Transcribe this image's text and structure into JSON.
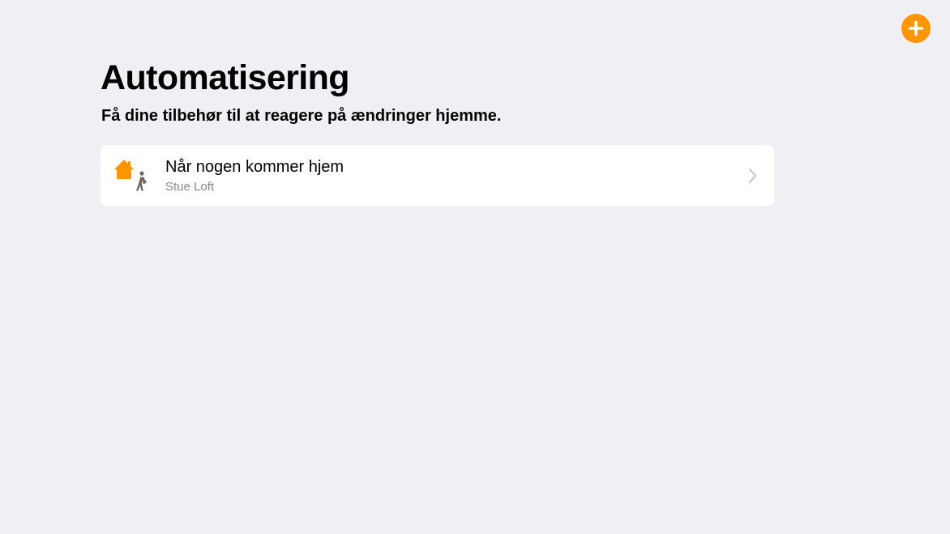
{
  "app": {
    "accent_color": "#ff9500",
    "background_color": "#efeff4"
  },
  "toolbar": {
    "add_button": {
      "icon": "plus-circle-icon",
      "color": "#ff9500"
    }
  },
  "header": {
    "title": "Automatisering",
    "subtitle": "Få dine tilbehør til at reagere på ændringer hjemme."
  },
  "automations": [
    {
      "title": "Når nogen kommer hjem",
      "subtitle": "Stue Loft",
      "icon": "house-person-arriving-icon",
      "chevron_icon": "chevron-right-icon"
    }
  ]
}
